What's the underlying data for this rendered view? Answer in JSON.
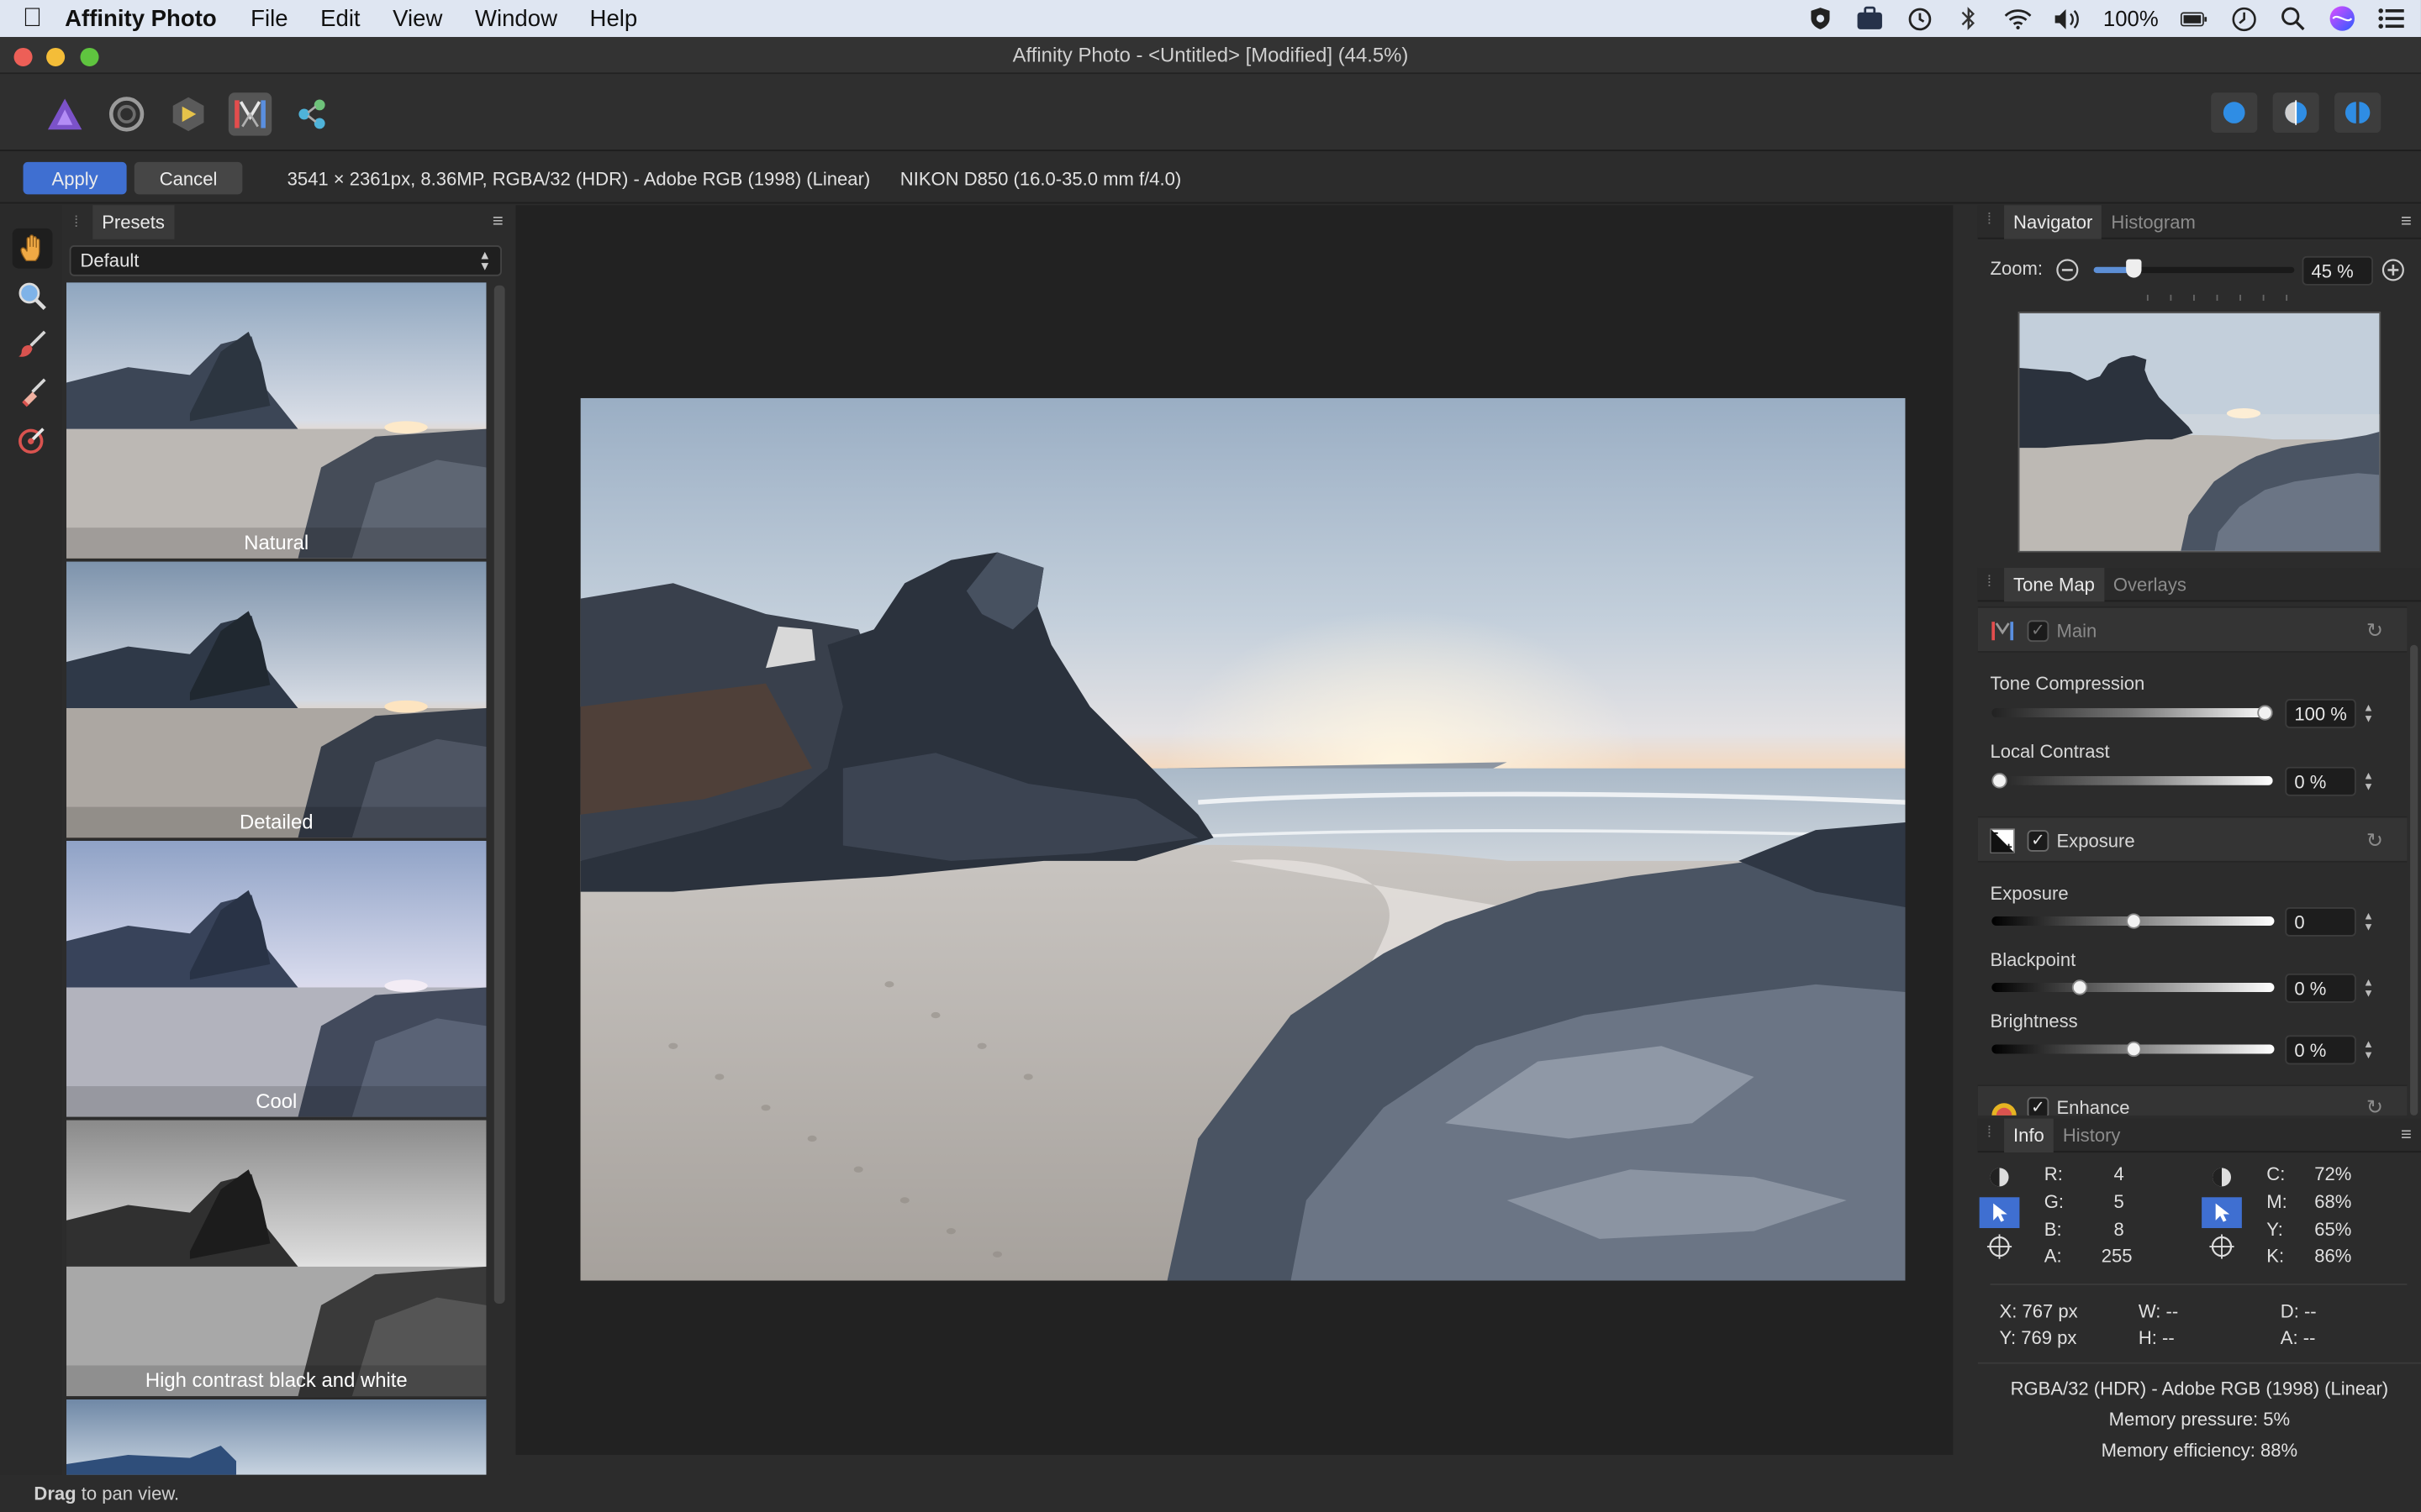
{
  "menubar": {
    "app_name": "Affinity Photo",
    "menus": [
      "File",
      "Edit",
      "View",
      "Window",
      "Help"
    ],
    "battery": "100%"
  },
  "window": {
    "title": "Affinity Photo - <Untitled> [Modified] (44.5%)"
  },
  "context_toolbar": {
    "apply_label": "Apply",
    "cancel_label": "Cancel",
    "doc_info": "3541 × 2361px, 8.36MP, RGBA/32 (HDR) - Adobe RGB (1998) (Linear)",
    "camera_info": "NIKON D850 (16.0-35.0 mm f/4.0)"
  },
  "presets": {
    "tab_label": "Presets",
    "selected_category": "Default",
    "items": [
      {
        "label": "Natural"
      },
      {
        "label": "Detailed"
      },
      {
        "label": "Cool"
      },
      {
        "label": "High contrast black and white"
      }
    ]
  },
  "status": {
    "bold": "Drag",
    "rest": " to pan view."
  },
  "navigator": {
    "tabs": [
      "Navigator",
      "Histogram"
    ],
    "zoom_label": "Zoom:",
    "zoom_value": "45 %",
    "zoom_fraction": 0.2
  },
  "tonemap": {
    "tabs": [
      "Tone Map",
      "Overlays"
    ],
    "main_label": "Main",
    "tone_compression": {
      "label": "Tone Compression",
      "value": "100 %",
      "fraction": 1.0
    },
    "local_contrast": {
      "label": "Local Contrast",
      "value": "0 %",
      "fraction": 0.0
    },
    "exposure_section": "Exposure",
    "exposure": {
      "label": "Exposure",
      "value": "0",
      "fraction": 0.5
    },
    "blackpoint": {
      "label": "Blackpoint",
      "value": "0 %",
      "fraction": 0.3
    },
    "brightness": {
      "label": "Brightness",
      "value": "0 %",
      "fraction": 0.5
    },
    "enhance_section": "Enhance"
  },
  "info": {
    "tabs": [
      "Info",
      "History"
    ],
    "rgb": [
      {
        "k": "R:",
        "v": "4"
      },
      {
        "k": "G:",
        "v": "5"
      },
      {
        "k": "B:",
        "v": "8"
      },
      {
        "k": "A:",
        "v": "255"
      }
    ],
    "cmyk": [
      {
        "k": "C:",
        "v": "72%"
      },
      {
        "k": "M:",
        "v": "68%"
      },
      {
        "k": "Y:",
        "v": "65%"
      },
      {
        "k": "K:",
        "v": "86%"
      }
    ],
    "x": "X: 767 px",
    "y": "Y: 769 px",
    "w": "W: --",
    "h": "H: --",
    "d": "D: --",
    "a": "A: --",
    "color_space": "RGBA/32 (HDR) - Adobe RGB (1998) (Linear)",
    "memory_pressure": "Memory pressure: 5%",
    "memory_efficiency": "Memory efficiency: 88%"
  },
  "colors": {
    "accent": "#3f6fd1",
    "panel": "#2c2c2c",
    "canvas": "#222222"
  }
}
